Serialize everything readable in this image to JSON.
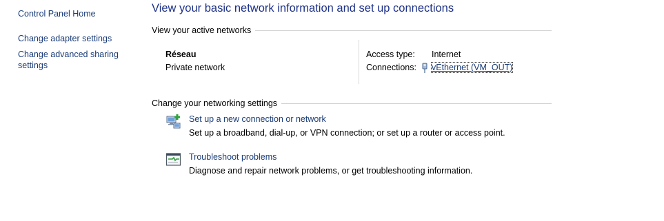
{
  "sidebar": {
    "home": "Control Panel Home",
    "items": [
      {
        "label": "Change adapter settings"
      },
      {
        "label": "Change advanced sharing settings"
      }
    ]
  },
  "main": {
    "title": "View your basic network information and set up connections",
    "active_networks": {
      "header": "View your active networks",
      "network_name": "Réseau",
      "network_category": "Private network",
      "access_type_label": "Access type:",
      "access_type_value": "Internet",
      "connections_label": "Connections:",
      "connection_name": "vEthernet (VM_OUT)"
    },
    "settings": {
      "header": "Change your networking settings",
      "tasks": [
        {
          "link": "Set up a new connection or network",
          "description": "Set up a broadband, dial-up, or VPN connection; or set up a router or access point.",
          "icon": "new-connection-icon"
        },
        {
          "link": "Troubleshoot problems",
          "description": "Diagnose and repair network problems, or get troubleshooting information.",
          "icon": "troubleshoot-icon"
        }
      ]
    }
  },
  "colors": {
    "link": "#1a3c78",
    "title": "#1e3287",
    "rule": "#d2d2d2"
  }
}
